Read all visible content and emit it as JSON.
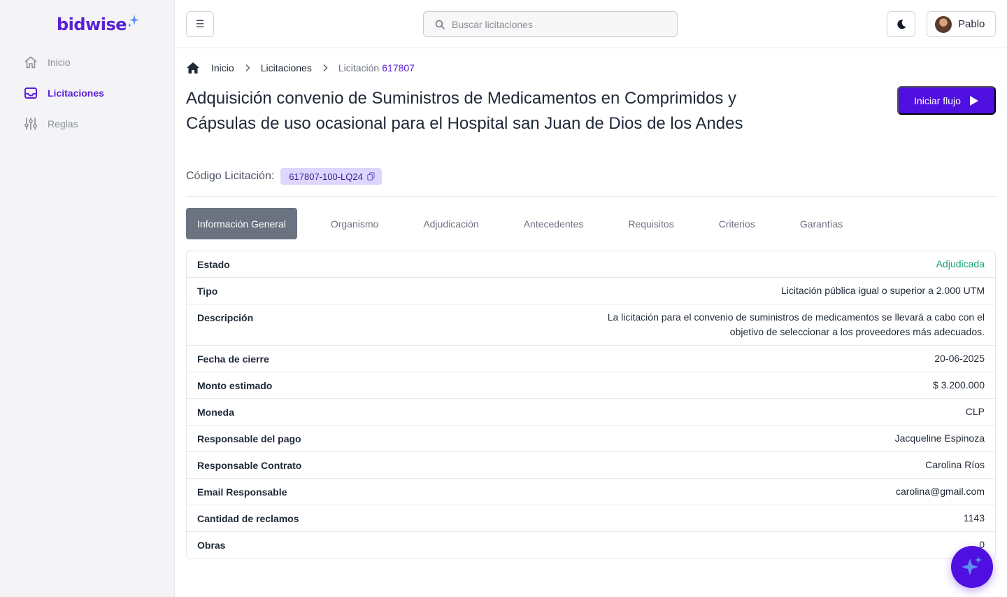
{
  "app": {
    "logo_text": "bidwise",
    "brand_color": "#5b21d6",
    "accent_color": "#4f0fe0"
  },
  "sidebar": {
    "items": [
      {
        "label": "Inicio",
        "icon": "home-icon",
        "active": false
      },
      {
        "label": "Licitaciones",
        "icon": "inbox-icon",
        "active": true
      },
      {
        "label": "Reglas",
        "icon": "sliders-icon",
        "active": false
      }
    ]
  },
  "topbar": {
    "menu_icon": "☰",
    "search_placeholder": "Buscar licitaciones",
    "user_name": "Pablo"
  },
  "breadcrumb": {
    "home": "Inicio",
    "section": "Licitaciones",
    "current": "Licitación",
    "current_code": "617807"
  },
  "header": {
    "title": "Adquisición convenio de Suministros de Medicamentos en Comprimidos y Cápsulas de uso ocasional para el Hospital san Juan de Dios de los Andes",
    "start_button": "Iniciar flujo",
    "code_label": "Código Licitación:",
    "code_value": "617807-100-LQ24"
  },
  "tabs": [
    {
      "label": "Información General",
      "active": true
    },
    {
      "label": "Organismo",
      "active": false
    },
    {
      "label": "Adjudicación",
      "active": false
    },
    {
      "label": "Antecedentes",
      "active": false
    },
    {
      "label": "Requisitos",
      "active": false
    },
    {
      "label": "Criterios",
      "active": false
    },
    {
      "label": "Garantías",
      "active": false
    }
  ],
  "details": {
    "rows": [
      {
        "key": "Estado",
        "value": "Adjudicada",
        "status_color": "#10a36b"
      },
      {
        "key": "Tipo",
        "value": "Licitación pública igual o superior a 2.000 UTM"
      },
      {
        "key": "Descripción",
        "value": "La licitación para el convenio de suministros de medicamentos se llevará a cabo con el objetivo de seleccionar a los proveedores más adecuados."
      },
      {
        "key": "Fecha de cierre",
        "value": "20-06-2025"
      },
      {
        "key": "Monto estimado",
        "value": "$ 3.200.000"
      },
      {
        "key": "Moneda",
        "value": "CLP"
      },
      {
        "key": "Responsable del pago",
        "value": "Jacqueline Espinoza"
      },
      {
        "key": "Responsable Contrato",
        "value": "Carolina Ríos"
      },
      {
        "key": "Email Responsable",
        "value": "carolina@gmail.com"
      },
      {
        "key": "Cantidad de reclamos",
        "value": "1143"
      },
      {
        "key": "Obras",
        "value": "0"
      }
    ]
  }
}
